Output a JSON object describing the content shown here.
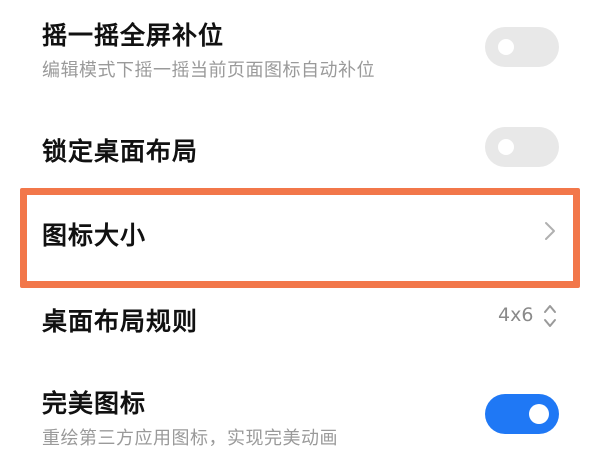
{
  "settings": {
    "shake_fill": {
      "title": "摇一摇全屏补位",
      "subtitle": "编辑模式下摇一摇当前页面图标自动补位",
      "enabled": false
    },
    "lock_layout": {
      "title": "锁定桌面布局",
      "enabled": false
    },
    "icon_size": {
      "title": "图标大小",
      "icon": "chevron-right-icon",
      "highlighted": true,
      "highlight_color": "#f2774a"
    },
    "layout_rule": {
      "title": "桌面布局规则",
      "value": "4x6",
      "icon": "up-down-arrows-icon"
    },
    "perfect_icons": {
      "title": "完美图标",
      "subtitle": "重绘第三方应用图标，实现完美动画",
      "enabled": true
    }
  },
  "colors": {
    "toggle_on": "#1f78f5",
    "toggle_off": "#e8e8e8",
    "subtitle": "#9a9a9a"
  }
}
